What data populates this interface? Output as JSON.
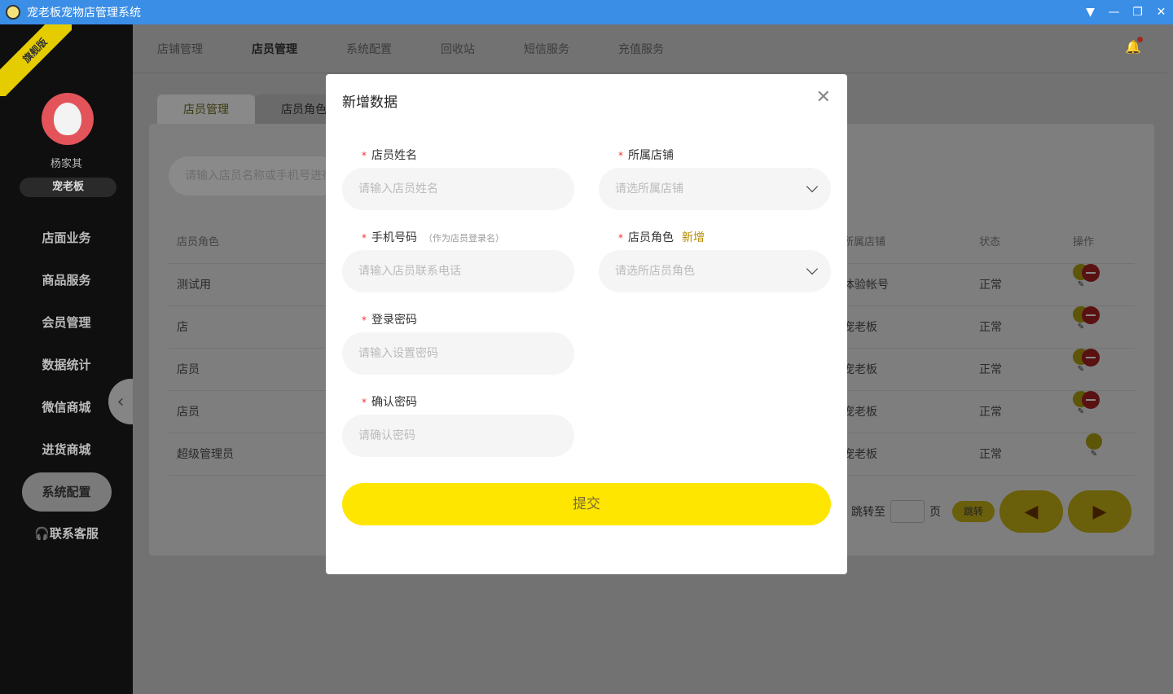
{
  "window": {
    "title": "宠老板宠物店管理系统"
  },
  "sidebar": {
    "edition_badge": "旗舰版",
    "username": "杨家其",
    "role": "宠老板",
    "items": [
      {
        "label": "店面业务"
      },
      {
        "label": "商品服务"
      },
      {
        "label": "会员管理"
      },
      {
        "label": "数据统计"
      },
      {
        "label": "微信商城"
      },
      {
        "label": "进货商城"
      },
      {
        "label": "系统配置"
      }
    ],
    "active_index": 6,
    "service": "联系客服"
  },
  "topnav": {
    "tabs": [
      {
        "label": "店铺管理"
      },
      {
        "label": "店员管理"
      },
      {
        "label": "系统配置"
      },
      {
        "label": "回收站"
      },
      {
        "label": "短信服务"
      },
      {
        "label": "充值服务"
      }
    ],
    "active_index": 1
  },
  "subtabs": [
    {
      "label": "店员管理"
    },
    {
      "label": "店员角色"
    }
  ],
  "search": {
    "placeholder": "请输入店员名称或手机号进行搜索"
  },
  "table": {
    "headers": {
      "role": "店员角色",
      "store": "所属店铺",
      "status": "状态",
      "op": "操作"
    },
    "rows": [
      {
        "role": "测试用",
        "store": "体验帐号",
        "status": "正常",
        "deletable": true
      },
      {
        "role": "店",
        "store": "宠老板",
        "status": "正常",
        "deletable": true
      },
      {
        "role": "店员",
        "store": "宠老板",
        "status": "正常",
        "deletable": true
      },
      {
        "role": "店员",
        "store": "宠老板",
        "status": "正常",
        "deletable": true
      },
      {
        "role": "超级管理员",
        "store": "宠老板",
        "status": "正常",
        "deletable": false
      }
    ]
  },
  "pager": {
    "jump_label": "跳转至",
    "page_unit": "页",
    "jump_button": "跳转"
  },
  "modal": {
    "title": "新增数据",
    "fields": {
      "name": {
        "label": "店员姓名",
        "placeholder": "请输入店员姓名"
      },
      "store": {
        "label": "所属店铺",
        "placeholder": "请选所属店铺"
      },
      "phone": {
        "label": "手机号码",
        "hint": "（作为店员登录名）",
        "placeholder": "请输入店员联系电话"
      },
      "role": {
        "label": "店员角色",
        "add_link": "新增",
        "placeholder": "请选所店员角色"
      },
      "password": {
        "label": "登录密码",
        "placeholder": "请输入设置密码"
      },
      "confirm": {
        "label": "确认密码",
        "placeholder": "请确认密码"
      }
    },
    "required_mark": "*",
    "submit": "提交"
  },
  "colors": {
    "accent": "#ffe600",
    "titlebar": "#3a8ee6",
    "sidebar": "#0f0f0f"
  }
}
